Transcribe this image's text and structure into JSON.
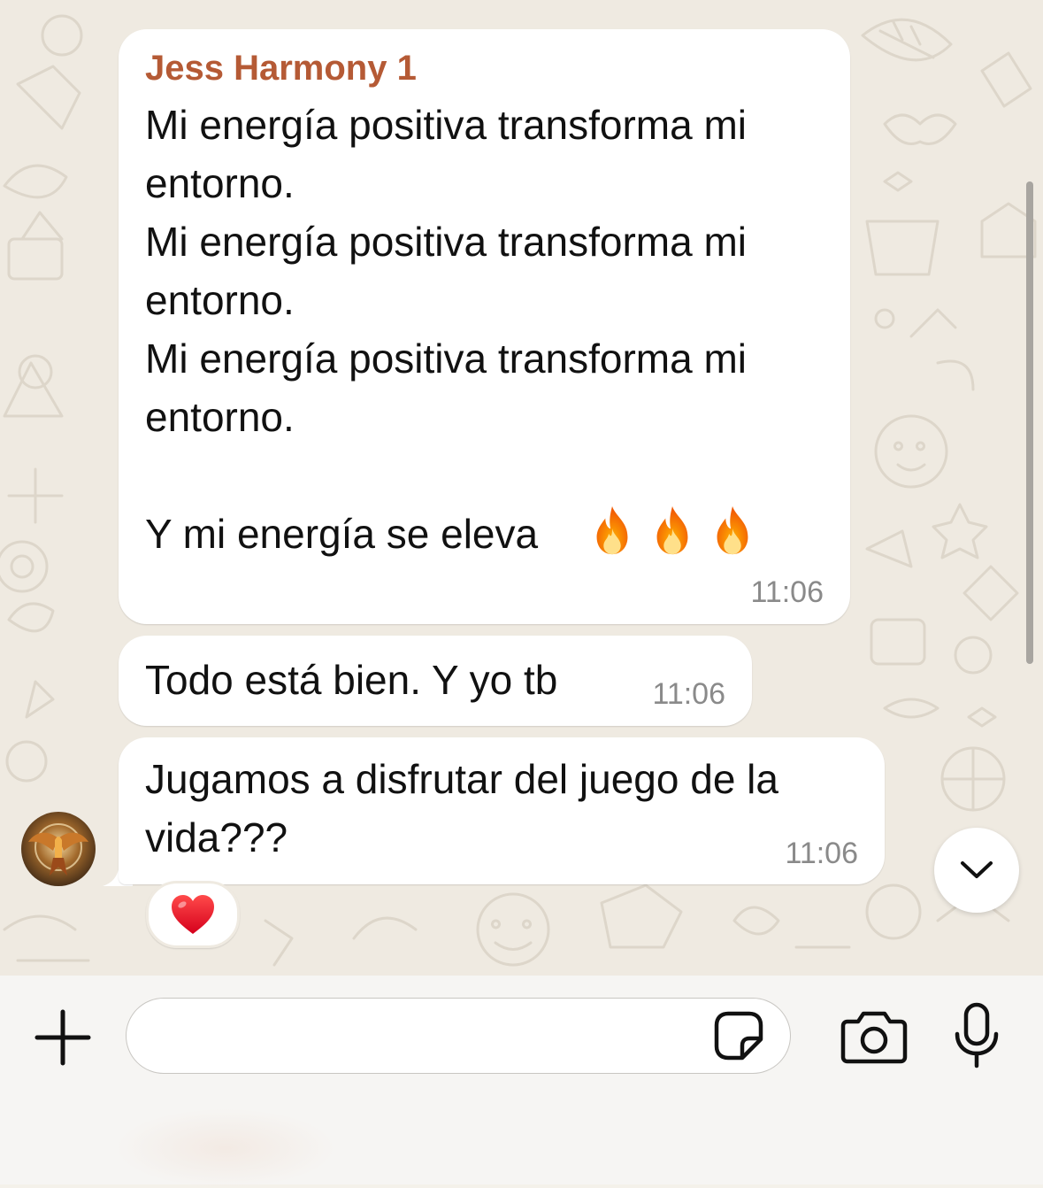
{
  "messages": [
    {
      "sender": "Jess Harmony 1",
      "text": "Mi energía positiva transforma mi entorno.\nMi energía positiva transforma mi entorno.\nMi energía positiva transforma mi entorno.\n\nY mi energía se eleva",
      "emoji": "🔥🔥🔥",
      "time": "11:06"
    },
    {
      "text": "Todo está bien. Y yo tb",
      "time": "11:06"
    },
    {
      "text": "Jugamos a disfrutar del juego de la vida???",
      "time": "11:06",
      "reaction": "❤️"
    }
  ],
  "composer": {
    "input_value": "",
    "input_placeholder": ""
  },
  "icons": {
    "plus": "plus-icon",
    "sticker": "sticker-icon",
    "camera": "camera-icon",
    "mic": "microphone-icon",
    "scroll_down": "chevron-down-icon",
    "reaction": "red-heart-icon",
    "emoji": "fire-icon"
  },
  "colors": {
    "sender_name": "#b55a35",
    "bubble": "#ffffff",
    "chat_background": "#efeae1",
    "timestamp": "#8a8a8a"
  }
}
